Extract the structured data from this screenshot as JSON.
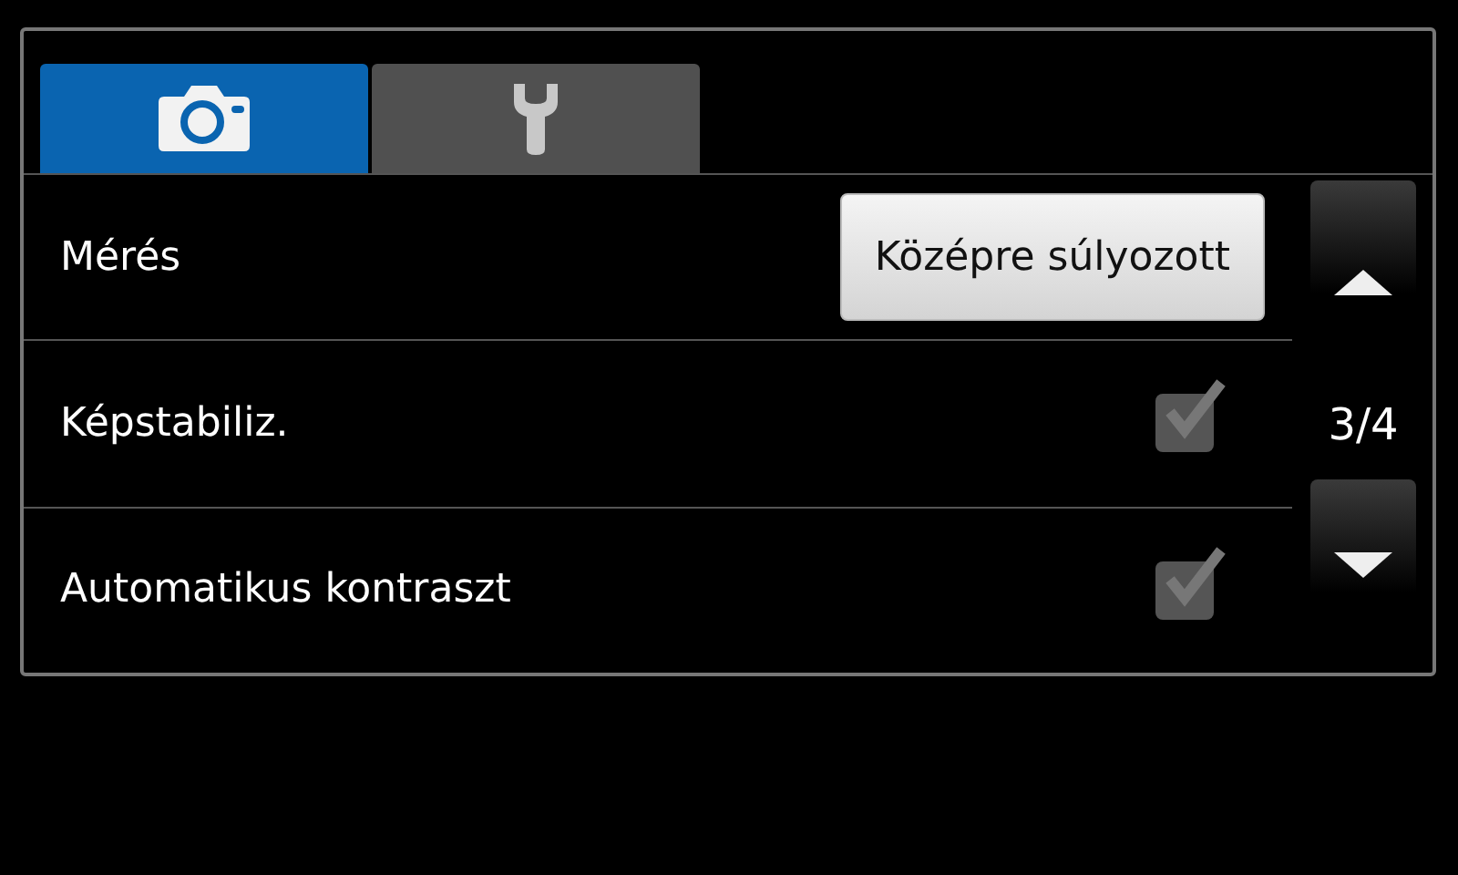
{
  "tabs": [
    {
      "kind": "camera",
      "selected": true
    },
    {
      "kind": "wrench",
      "selected": false
    }
  ],
  "settings": [
    {
      "kind": "choice",
      "label": "Mérés",
      "value": "Középre súlyozott"
    },
    {
      "kind": "checkbox",
      "label": "Képstabiliz.",
      "checked": true,
      "disabled": true
    },
    {
      "kind": "checkbox",
      "label": "Automatikus kontraszt",
      "checked": true,
      "disabled": true
    }
  ],
  "pager": {
    "page": "3/4"
  }
}
